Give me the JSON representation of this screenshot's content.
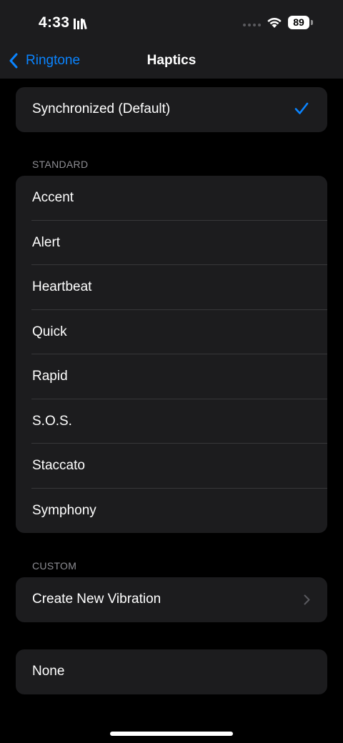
{
  "status_bar": {
    "time": "4:33",
    "battery": "89"
  },
  "nav": {
    "back_label": "Ringtone",
    "title": "Haptics"
  },
  "selected_group": {
    "items": [
      {
        "label": "Synchronized (Default)",
        "checked": true
      }
    ]
  },
  "standard": {
    "header": "STANDARD",
    "items": [
      {
        "label": "Accent"
      },
      {
        "label": "Alert"
      },
      {
        "label": "Heartbeat"
      },
      {
        "label": "Quick"
      },
      {
        "label": "Rapid"
      },
      {
        "label": "S.O.S."
      },
      {
        "label": "Staccato"
      },
      {
        "label": "Symphony"
      }
    ]
  },
  "custom": {
    "header": "CUSTOM",
    "items": [
      {
        "label": "Create New Vibration"
      }
    ]
  },
  "none_group": {
    "items": [
      {
        "label": "None"
      }
    ]
  },
  "colors": {
    "accent": "#0a84ff",
    "background": "#000000",
    "cell": "#1c1c1e",
    "separator": "#38383a",
    "secondary_text": "#8d8d93"
  }
}
